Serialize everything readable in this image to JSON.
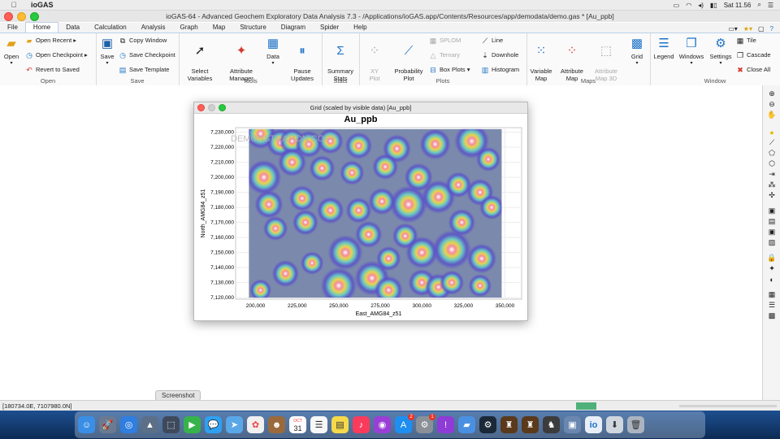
{
  "menubar": {
    "app": "ioGAS",
    "time": "Sat 11.56"
  },
  "window": {
    "title": "ioGAS-64 - Advanced Geochem Exploratory Data Analysis 7.3 - /Applications/ioGAS.app/Contents/Resources/app/demodata/demo.gas * [Au_ppb]"
  },
  "tabs": [
    "File",
    "Home",
    "Data",
    "Calculation",
    "Analysis",
    "Graph",
    "Map",
    "Structure",
    "Diagram",
    "Spider",
    "Help"
  ],
  "ribbon": {
    "open": {
      "big": "Open",
      "recent": "Open Recent",
      "checkpoint": "Open Checkpoint",
      "revert": "Revert to Saved",
      "label": "Open"
    },
    "save": {
      "big": "Save",
      "copy": "Copy Window",
      "checkpoint": "Save Checkpoint",
      "template": "Save Template",
      "label": "Save"
    },
    "tools": {
      "select": "Select\nVariables",
      "attr": "Attribute\nManager",
      "data": "Data",
      "pause": "Pause\nUpdates",
      "label": "Tools"
    },
    "stats": {
      "summary": "Summary\nStats",
      "label": "Stats"
    },
    "plots": {
      "xy": "XY\nPlot",
      "prob": "Probability\nPlot",
      "splom": "SPLOM",
      "ternary": "Ternary",
      "box": "Box Plots",
      "line": "Line",
      "downhole": "Downhole",
      "histogram": "Histogram",
      "label": "Plots"
    },
    "maps": {
      "var": "Variable\nMap",
      "attr": "Attribute\nMap",
      "attr3d": "Attribute\nMap 3D",
      "grid": "Grid",
      "label": "Maps"
    },
    "window": {
      "legend": "Legend",
      "windows": "Windows",
      "settings": "Settings",
      "tile": "Tile",
      "cascade": "Cascade",
      "closeall": "Close All",
      "label": "Window"
    }
  },
  "plot": {
    "window_title": "Grid (scaled by visible data)  [Au_ppb]",
    "watermark": "DEMONSTRATION COPY"
  },
  "chart_data": {
    "type": "heatmap",
    "title": "Au_ppb",
    "xlabel": "East_AMG84_z51",
    "ylabel": "North_AMG84_z51",
    "xticks": [
      "200,000",
      "225,000",
      "250,000",
      "275,000",
      "300,000",
      "325,000",
      "350,000"
    ],
    "yticks": [
      "7,120,000",
      "7,130,000",
      "7,140,000",
      "7,150,000",
      "7,160,000",
      "7,170,000",
      "7,180,000",
      "7,190,000",
      "7,200,000",
      "7,210,000",
      "7,220,000",
      "7,230,000"
    ],
    "xlim": [
      188000,
      360000
    ],
    "ylim": [
      7119000,
      7233000
    ],
    "extent": {
      "x": [
        196000,
        348000
      ],
      "y": [
        7120000,
        7232000
      ]
    },
    "blobs": [
      {
        "x": 203000,
        "y": 7229000,
        "v": 0.7
      },
      {
        "x": 215000,
        "y": 7223000,
        "v": 0.6
      },
      {
        "x": 222000,
        "y": 7224000,
        "v": 0.5
      },
      {
        "x": 232000,
        "y": 7222000,
        "v": 0.55
      },
      {
        "x": 245000,
        "y": 7224000,
        "v": 0.5
      },
      {
        "x": 262000,
        "y": 7221000,
        "v": 0.55
      },
      {
        "x": 285000,
        "y": 7219000,
        "v": 0.6
      },
      {
        "x": 308000,
        "y": 7222000,
        "v": 0.7
      },
      {
        "x": 330000,
        "y": 7224000,
        "v": 0.85
      },
      {
        "x": 340000,
        "y": 7212000,
        "v": 0.45
      },
      {
        "x": 205000,
        "y": 7200000,
        "v": 0.85
      },
      {
        "x": 222000,
        "y": 7210000,
        "v": 0.6
      },
      {
        "x": 240000,
        "y": 7206000,
        "v": 0.5
      },
      {
        "x": 258000,
        "y": 7203000,
        "v": 0.45
      },
      {
        "x": 278000,
        "y": 7207000,
        "v": 0.5
      },
      {
        "x": 298000,
        "y": 7200000,
        "v": 0.6
      },
      {
        "x": 310000,
        "y": 7187000,
        "v": 0.8
      },
      {
        "x": 292000,
        "y": 7182000,
        "v": 0.95
      },
      {
        "x": 276000,
        "y": 7184000,
        "v": 0.55
      },
      {
        "x": 322000,
        "y": 7195000,
        "v": 0.5
      },
      {
        "x": 335000,
        "y": 7190000,
        "v": 0.55
      },
      {
        "x": 208000,
        "y": 7182000,
        "v": 0.6
      },
      {
        "x": 228000,
        "y": 7186000,
        "v": 0.5
      },
      {
        "x": 245000,
        "y": 7178000,
        "v": 0.55
      },
      {
        "x": 262000,
        "y": 7178000,
        "v": 0.5
      },
      {
        "x": 324000,
        "y": 7170000,
        "v": 0.55
      },
      {
        "x": 342000,
        "y": 7180000,
        "v": 0.45
      },
      {
        "x": 212000,
        "y": 7166000,
        "v": 0.45
      },
      {
        "x": 230000,
        "y": 7170000,
        "v": 0.5
      },
      {
        "x": 268000,
        "y": 7162000,
        "v": 0.55
      },
      {
        "x": 290000,
        "y": 7161000,
        "v": 0.5
      },
      {
        "x": 300000,
        "y": 7150000,
        "v": 0.75
      },
      {
        "x": 318000,
        "y": 7152000,
        "v": 1.0
      },
      {
        "x": 336000,
        "y": 7146000,
        "v": 0.65
      },
      {
        "x": 254000,
        "y": 7150000,
        "v": 0.85
      },
      {
        "x": 280000,
        "y": 7146000,
        "v": 0.45
      },
      {
        "x": 234000,
        "y": 7143000,
        "v": 0.4
      },
      {
        "x": 218000,
        "y": 7136000,
        "v": 0.55
      },
      {
        "x": 270000,
        "y": 7133000,
        "v": 0.85
      },
      {
        "x": 250000,
        "y": 7128000,
        "v": 0.9
      },
      {
        "x": 280000,
        "y": 7125000,
        "v": 0.6
      },
      {
        "x": 300000,
        "y": 7130000,
        "v": 0.55
      },
      {
        "x": 310000,
        "y": 7127000,
        "v": 0.55
      },
      {
        "x": 318000,
        "y": 7130000,
        "v": 0.45
      },
      {
        "x": 335000,
        "y": 7128000,
        "v": 0.4
      },
      {
        "x": 203000,
        "y": 7125000,
        "v": 0.35
      }
    ]
  },
  "status": {
    "coords": "[180734.0E, 7107980.0N]",
    "progress": 0.2
  },
  "tooltip": "Screenshot",
  "dock": {
    "calendar_day": "31",
    "appstore_badge": "2",
    "settings_badge": "1"
  },
  "colors": {
    "grid_bg": "#7b8aac",
    "accent": "#1d72c6"
  }
}
